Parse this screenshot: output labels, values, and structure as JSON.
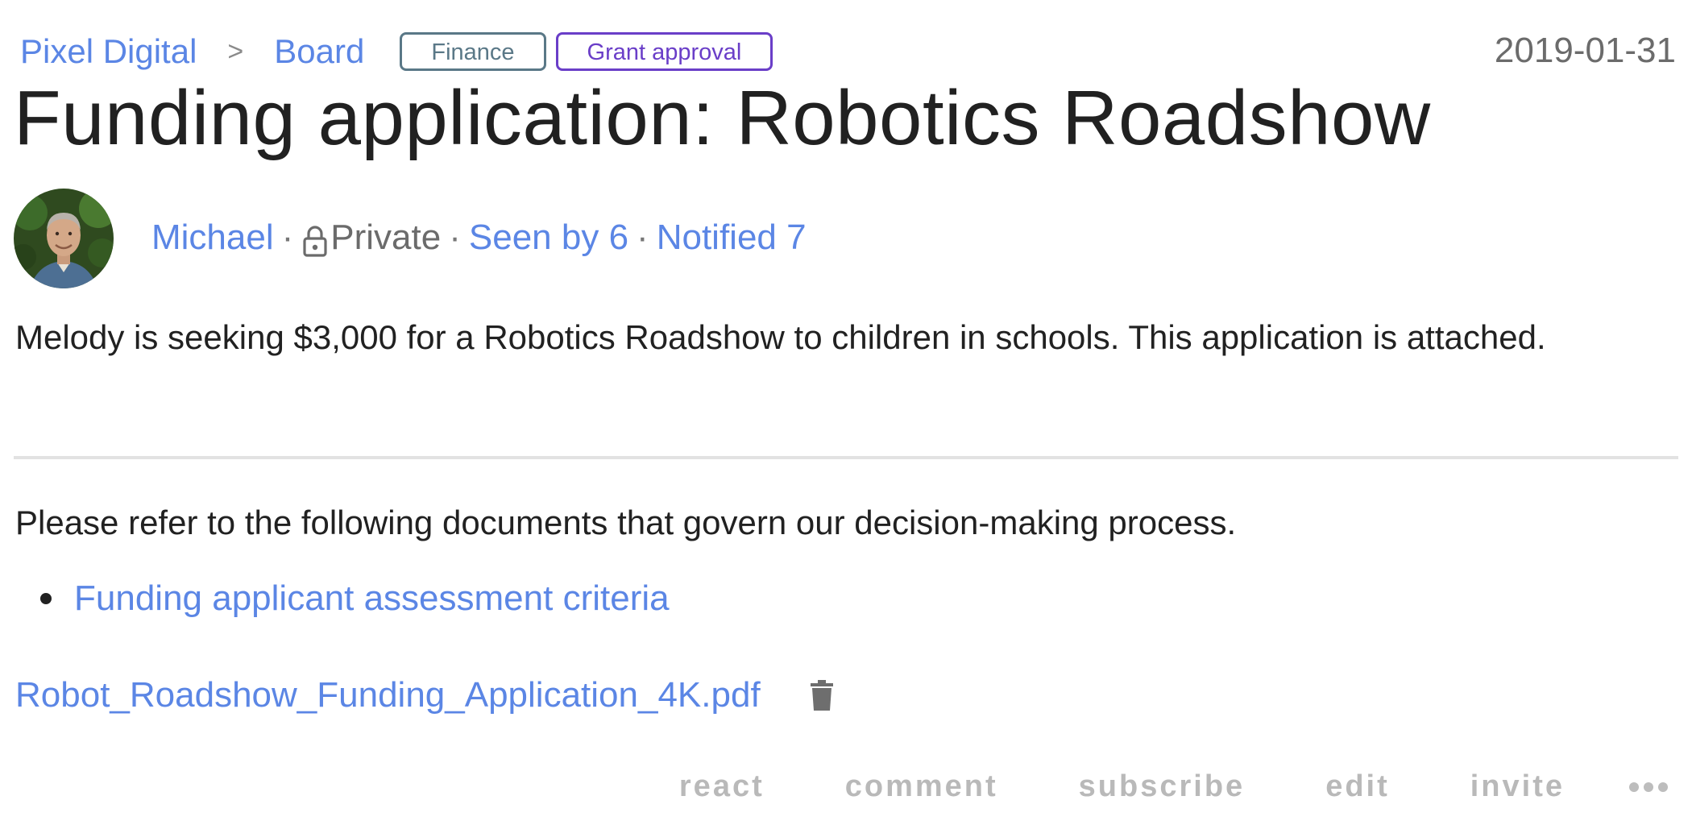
{
  "breadcrumb": {
    "org": "Pixel Digital",
    "separator": ">",
    "section": "Board"
  },
  "tags": [
    {
      "label": "Finance",
      "color": "#5a7887"
    },
    {
      "label": "Grant approval",
      "color": "#6a3ec8"
    }
  ],
  "date": "2019-01-31",
  "post": {
    "title": "Funding application: Robotics Roadshow",
    "author": "Michael",
    "visibility": "Private",
    "seen": "Seen by 6",
    "notified": "Notified 7",
    "separator": "·",
    "body": "Melody is seeking $3,000 for a Robotics Roadshow to children in schools. This application is attached.",
    "refer_text": "Please refer to the following documents that govern our decision-making process.",
    "documents": [
      "Funding applicant assessment criteria"
    ],
    "attachment": "Robot_Roadshow_Funding_Application_4K.pdf"
  },
  "icons": {
    "avatar": "avatar",
    "lock": "lock-icon",
    "trash": "trash-icon",
    "more": "more-icon"
  },
  "actions": {
    "react": "react",
    "comment": "comment",
    "subscribe": "subscribe",
    "edit": "edit",
    "invite": "invite"
  },
  "colors": {
    "link": "#5b86e5",
    "text": "#212121",
    "muted": "#6b6b6b",
    "action": "#b9b9b9"
  }
}
